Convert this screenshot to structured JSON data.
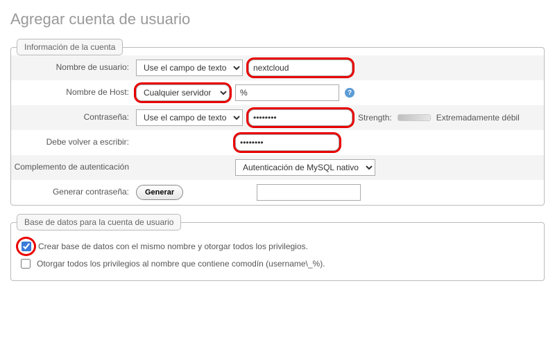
{
  "page": {
    "title": "Agregar cuenta de usuario"
  },
  "fieldset_account": {
    "legend": "Información de la cuenta",
    "username": {
      "label": "Nombre de usuario:",
      "select": "Use el campo de texto",
      "value": "nextcloud"
    },
    "host": {
      "label": "Nombre de Host:",
      "select": "Cualquier servidor",
      "value": "%"
    },
    "password": {
      "label": "Contraseña:",
      "select": "Use el campo de texto",
      "value": "••••••••",
      "strength_label": "Strength:",
      "strength_text": "Extremadamente débil"
    },
    "repeat": {
      "label": "Debe volver a escribir:",
      "value": "••••••••"
    },
    "authplugin": {
      "label": "Complemento de autenticación",
      "select": "Autenticación de MySQL nativo"
    },
    "generate": {
      "label": "Generar contraseña:",
      "button": "Generar"
    }
  },
  "fieldset_db": {
    "legend": "Base de datos para la cuenta de usuario",
    "opt1": {
      "checked": true,
      "label": "Crear base de datos con el mismo nombre y otorgar todos los privilegios."
    },
    "opt2": {
      "checked": false,
      "label": "Otorgar todos los privilegios al nombre que contiene comodín (username\\_%)."
    }
  }
}
